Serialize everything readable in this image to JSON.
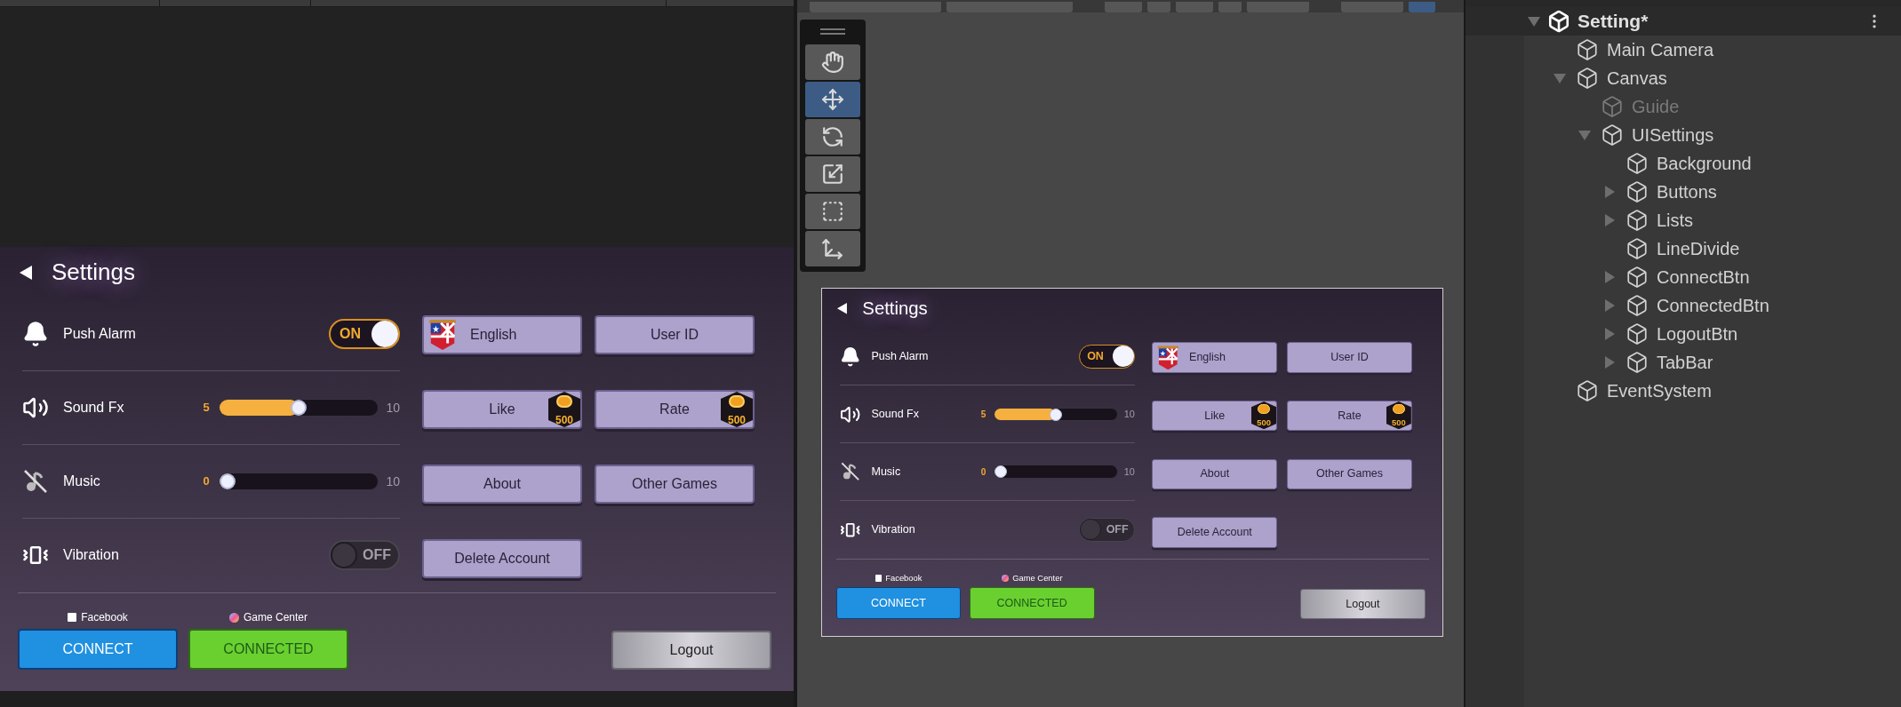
{
  "panels": [
    {
      "title": "Settings",
      "rows": [
        {
          "kind": "toggle",
          "label": "Push Alarm",
          "on": true,
          "state_label": "ON"
        },
        {
          "kind": "slider",
          "label": "Sound Fx",
          "level": 0.5,
          "value": "5",
          "max": "10"
        },
        {
          "kind": "slider",
          "label": "Music",
          "level": 0,
          "value": "0",
          "max": "10"
        },
        {
          "kind": "toggle",
          "label": "Vibration",
          "on": false,
          "state_label": "OFF"
        }
      ],
      "buttons": [
        {
          "label": "English",
          "kind": "language"
        },
        {
          "label": "User ID",
          "kind": "plain"
        },
        {
          "label": "Like",
          "kind": "reward",
          "reward": "500"
        },
        {
          "label": "Rate",
          "kind": "reward",
          "reward": "500"
        },
        {
          "label": "About",
          "kind": "plain"
        },
        {
          "label": "Other Games",
          "kind": "plain"
        },
        {
          "label": "Delete Account",
          "kind": "plain"
        }
      ],
      "accounts": [
        {
          "label": "Facebook",
          "button": "CONNECT",
          "connected": false
        },
        {
          "label": "Game Center",
          "button": "CONNECTED",
          "connected": true
        }
      ],
      "logout": "Logout"
    },
    {
      "title": "Settings",
      "rows": [
        {
          "kind": "toggle",
          "label": "Push Alarm",
          "on": true,
          "state_label": "ON"
        },
        {
          "kind": "slider",
          "label": "Sound Fx",
          "level": 0.5,
          "value": "5",
          "max": "10"
        },
        {
          "kind": "slider",
          "label": "Music",
          "level": 0,
          "value": "0",
          "max": "10"
        },
        {
          "kind": "toggle",
          "label": "Vibration",
          "on": false,
          "state_label": "OFF"
        }
      ],
      "buttons": [
        {
          "label": "English",
          "kind": "language"
        },
        {
          "label": "User ID",
          "kind": "plain"
        },
        {
          "label": "Like",
          "kind": "reward",
          "reward": "500"
        },
        {
          "label": "Rate",
          "kind": "reward",
          "reward": "500"
        },
        {
          "label": "About",
          "kind": "plain"
        },
        {
          "label": "Other Games",
          "kind": "plain"
        },
        {
          "label": "Delete Account",
          "kind": "plain"
        }
      ],
      "accounts": [
        {
          "label": "Facebook",
          "button": "CONNECT",
          "connected": false
        },
        {
          "label": "Game Center",
          "button": "CONNECTED",
          "connected": true
        }
      ],
      "logout": "Logout"
    }
  ],
  "scene_tools": [
    {
      "kind": "hand",
      "selected": false
    },
    {
      "kind": "move",
      "selected": true
    },
    {
      "kind": "rotate",
      "selected": false
    },
    {
      "kind": "scale",
      "selected": false
    },
    {
      "kind": "rect",
      "selected": false
    },
    {
      "kind": "transform",
      "selected": false
    }
  ],
  "hierarchy": {
    "scene": "Setting*",
    "scene_expanded": true,
    "items": [
      {
        "label": "Main Camera",
        "disabled": false
      },
      {
        "label": "Canvas",
        "disabled": false,
        "expanded": true,
        "children": [
          {
            "label": "Guide",
            "disabled": true
          },
          {
            "label": "UISettings",
            "disabled": false,
            "expanded": true,
            "children": [
              {
                "label": "Background",
                "disabled": false
              },
              {
                "label": "Buttons",
                "disabled": false,
                "expanded": false
              },
              {
                "label": "Lists",
                "disabled": false,
                "expanded": false
              },
              {
                "label": "LineDivide",
                "disabled": false
              },
              {
                "label": "ConnectBtn",
                "disabled": false,
                "expanded": false
              },
              {
                "label": "ConnectedBtn",
                "disabled": false,
                "expanded": false
              },
              {
                "label": "LogoutBtn",
                "disabled": false,
                "expanded": false
              },
              {
                "label": "TabBar",
                "disabled": false,
                "expanded": false
              }
            ]
          }
        ]
      },
      {
        "label": "EventSystem",
        "disabled": false
      }
    ]
  }
}
